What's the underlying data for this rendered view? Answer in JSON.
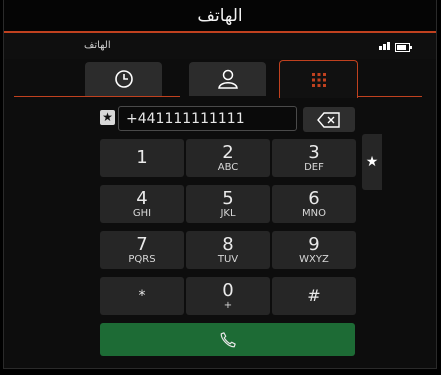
{
  "app": {
    "title": "الهاتف"
  },
  "status": {
    "operator": "الهاتف"
  },
  "tabs": [
    {
      "name": "recent-calls",
      "icon": "clock-icon"
    },
    {
      "name": "contacts",
      "icon": "person-icon"
    },
    {
      "name": "keypad",
      "icon": "keypad-icon",
      "active": true
    }
  ],
  "dialer": {
    "number": "+441111111111",
    "star_glyph": "★",
    "keys": [
      {
        "digit": "1",
        "letters": ""
      },
      {
        "digit": "2",
        "letters": "ABC"
      },
      {
        "digit": "3",
        "letters": "DEF"
      },
      {
        "digit": "4",
        "letters": "GHI"
      },
      {
        "digit": "5",
        "letters": "JKL"
      },
      {
        "digit": "6",
        "letters": "MNO"
      },
      {
        "digit": "7",
        "letters": "PQRS"
      },
      {
        "digit": "8",
        "letters": "TUV"
      },
      {
        "digit": "9",
        "letters": "WXYZ"
      },
      {
        "digit": "*",
        "letters": ""
      },
      {
        "digit": "0",
        "letters": "+"
      },
      {
        "digit": "#",
        "letters": ""
      }
    ],
    "side_glyph": "★"
  },
  "colors": {
    "accent": "#c0411f",
    "call": "#1d6b35"
  }
}
